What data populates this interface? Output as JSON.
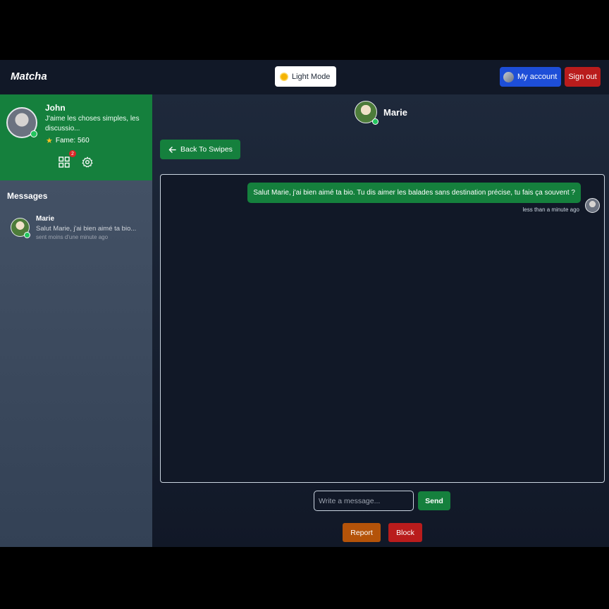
{
  "header": {
    "logo": "Matcha",
    "theme_toggle_label": "Light Mode",
    "account_label": "My account",
    "signout_label": "Sign out"
  },
  "profile": {
    "name": "John",
    "bio": "J'aime les choses simples, les discussio...",
    "fame": "Fame: 560",
    "notification_count": "2",
    "online": true
  },
  "sidebar": {
    "messages_title": "Messages",
    "conversations": [
      {
        "name": "Marie",
        "preview": "Salut Marie, j'ai bien aimé ta bio...",
        "time": "sent moins d'une minute ago",
        "online": true
      }
    ]
  },
  "chat": {
    "partner_name": "Marie",
    "back_label": "Back To Swipes",
    "messages": [
      {
        "text": "Salut Marie, j'ai bien aimé ta bio. Tu dis aimer les balades sans destination précise, tu fais ça souvent ?",
        "time": "less than a minute ago",
        "from_me": true
      }
    ],
    "input_placeholder": "Write a message...",
    "send_label": "Send",
    "report_label": "Report",
    "block_label": "Block"
  },
  "colors": {
    "header_bg": "#111827",
    "profile_bg": "#15803d",
    "accent_green": "#15803d",
    "account_blue": "#1d4ed8",
    "danger_red": "#b91c1c",
    "report_orange": "#b45309",
    "online_dot": "#22c55e"
  },
  "icons": [
    "sun-icon",
    "star-icon",
    "grid-icon",
    "gear-icon",
    "arrow-left-icon"
  ]
}
